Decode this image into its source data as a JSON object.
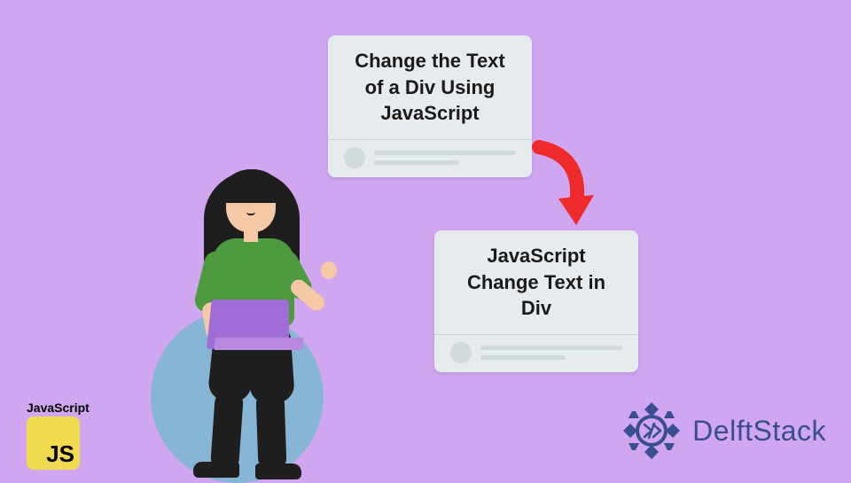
{
  "cards": {
    "card1": "Change the Text of a Div Using JavaScript",
    "card2": "JavaScript Change Text in Div"
  },
  "badges": {
    "js_label": "JavaScript",
    "js_text": "JS"
  },
  "brand": {
    "name": "DelftStack"
  },
  "colors": {
    "bg": "#cfa6ef",
    "card_bg": "#e6ecee",
    "arrow": "#ee2a2a",
    "js_yellow": "#f0db4f",
    "brand_blue": "#3a4d8f",
    "shirt": "#4e9b3f",
    "laptop": "#a06cd5",
    "ball": "#87b5d6"
  }
}
